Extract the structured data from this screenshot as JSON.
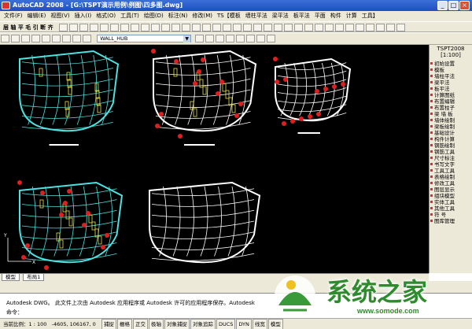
{
  "window": {
    "title": "AutoCAD 2008 - [G:\\TSPT演示用例\\例图\\四多图.dwg]",
    "btn_min": "_",
    "btn_max": "□",
    "btn_close": "×"
  },
  "menu": [
    "文件(F)",
    "编辑(E)",
    "视图(V)",
    "插入(I)",
    "格式(O)",
    "工具(T)",
    "绘图(D)",
    "标注(N)",
    "修改(M)",
    "TS【模板",
    "墙柱平法",
    "梁平法",
    "板平法",
    "平面",
    "构件",
    "计算",
    "工具】"
  ],
  "layer_dropdown": "WALL_HUB",
  "font_label": "层 轴 平 毛 引 断 齐",
  "right_panel": {
    "title": "TSPT2008",
    "scale": "[1:100]",
    "items": [
      "初始设置",
      "模板",
      "墙柱平法",
      "梁平法",
      "板平法",
      "计算图纸",
      "布置编辑",
      "布置柱子",
      "梁 墙 板",
      "墙体绘制",
      "梁板绘制",
      "基础设计",
      "构件计算",
      "钢筋绘制",
      "钢筋工具",
      "尺寸标注",
      "书写文字",
      "工具工具",
      "表格绘制",
      "修改工具",
      "图层显示",
      "组块模型",
      "实体工具",
      "其他工具",
      "符 号",
      "图库管理"
    ]
  },
  "tabs": [
    "模型",
    "布局1"
  ],
  "command": {
    "line1": "Autodesk DWG。  此文件上次由 Autodesk 应用程序或 Autodesk 许可的应用程序保存。Autodesk",
    "prompt": "命令："
  },
  "status": {
    "scale": "当前比例：1 : 100",
    "coords": "-4605, 106167, 0",
    "toggles": [
      "捕捉",
      "栅格",
      "正交",
      "极轴",
      "对象捕捉",
      "对象追踪",
      "DUCS",
      "DYN",
      "线宽",
      "模型"
    ]
  },
  "watermark": {
    "text": "系统之家",
    "url": "www.somode.com"
  },
  "colors": {
    "canvas": "#000000",
    "cyan": "#4fe0e0",
    "white": "#ffffff",
    "yellow": "#e8e040",
    "red": "#e02020"
  }
}
